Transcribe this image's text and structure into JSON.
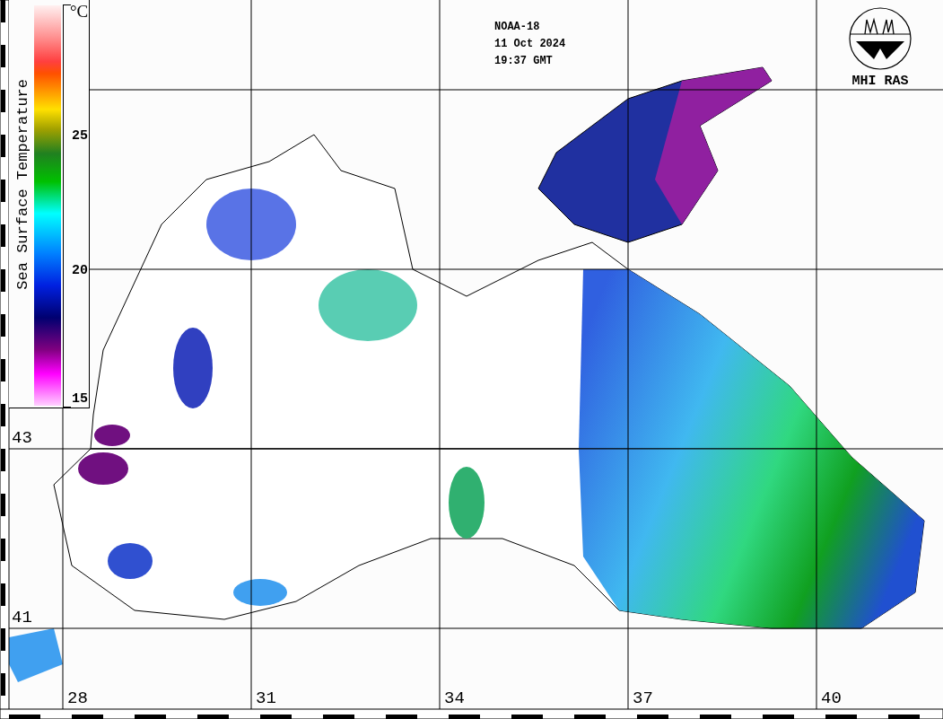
{
  "legend": {
    "title": "Sea Surface Temperature",
    "unit": "°C",
    "ticks": [
      "25",
      "20",
      "15"
    ]
  },
  "info": [
    "NOAA-18",
    "11 Oct 2024",
    "19:37 GMT"
  ],
  "logo": {
    "text": "MHI RAS"
  },
  "latitudes": [
    "43",
    "41"
  ],
  "longitudes": [
    "28",
    "31",
    "34",
    "37",
    "40"
  ]
}
